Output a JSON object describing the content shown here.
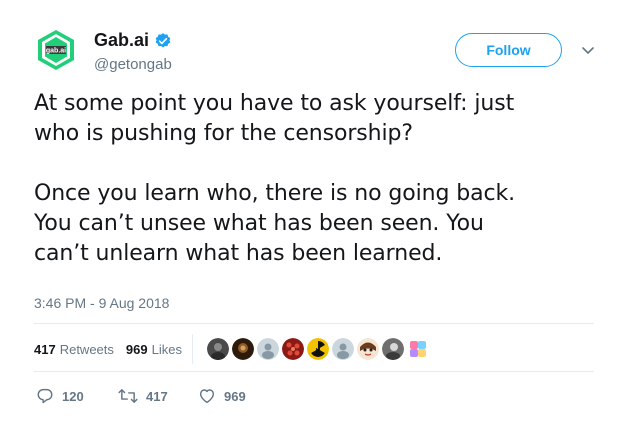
{
  "author": {
    "display_name": "Gab.ai",
    "handle": "@getongab",
    "verified": true,
    "avatar_label": "gab.ai",
    "avatar_color": "#21cf7a"
  },
  "follow_button": {
    "label": "Follow",
    "color": "#1da1f2"
  },
  "tweet": {
    "paragraphs": [
      "At some point you have to ask yourself: just\nwho is pushing for the censorship?",
      "Once you learn who, there is no going back.\nYou can’t unsee what has been seen. You\ncan’t unlearn what has been learned."
    ],
    "timestamp": "3:46 PM - 9 Aug 2018"
  },
  "stats": {
    "retweets_count": "417",
    "retweets_label": "Retweets",
    "likes_count": "969",
    "likes_label": "Likes"
  },
  "likers": [
    {
      "icon": "dark-photo-avatar",
      "color": "#4a4a4a"
    },
    {
      "icon": "brown-photo-avatar",
      "color": "#5a3b1e"
    },
    {
      "icon": "default-profile-avatar",
      "color": "#ccd6dd"
    },
    {
      "icon": "red-pattern-avatar",
      "color": "#b3261e"
    },
    {
      "icon": "radiation-symbol-avatar",
      "color": "#f2c200"
    },
    {
      "icon": "default-profile-avatar",
      "color": "#ccd6dd"
    },
    {
      "icon": "cartoon-face-avatar",
      "color": "#e8c9a8"
    },
    {
      "icon": "grey-photo-avatar",
      "color": "#6e6e6e"
    },
    {
      "icon": "colorful-tiles-avatar",
      "color": "#ff7aa8"
    }
  ],
  "actions": {
    "reply_count": "120",
    "retweet_count": "417",
    "like_count": "969"
  }
}
